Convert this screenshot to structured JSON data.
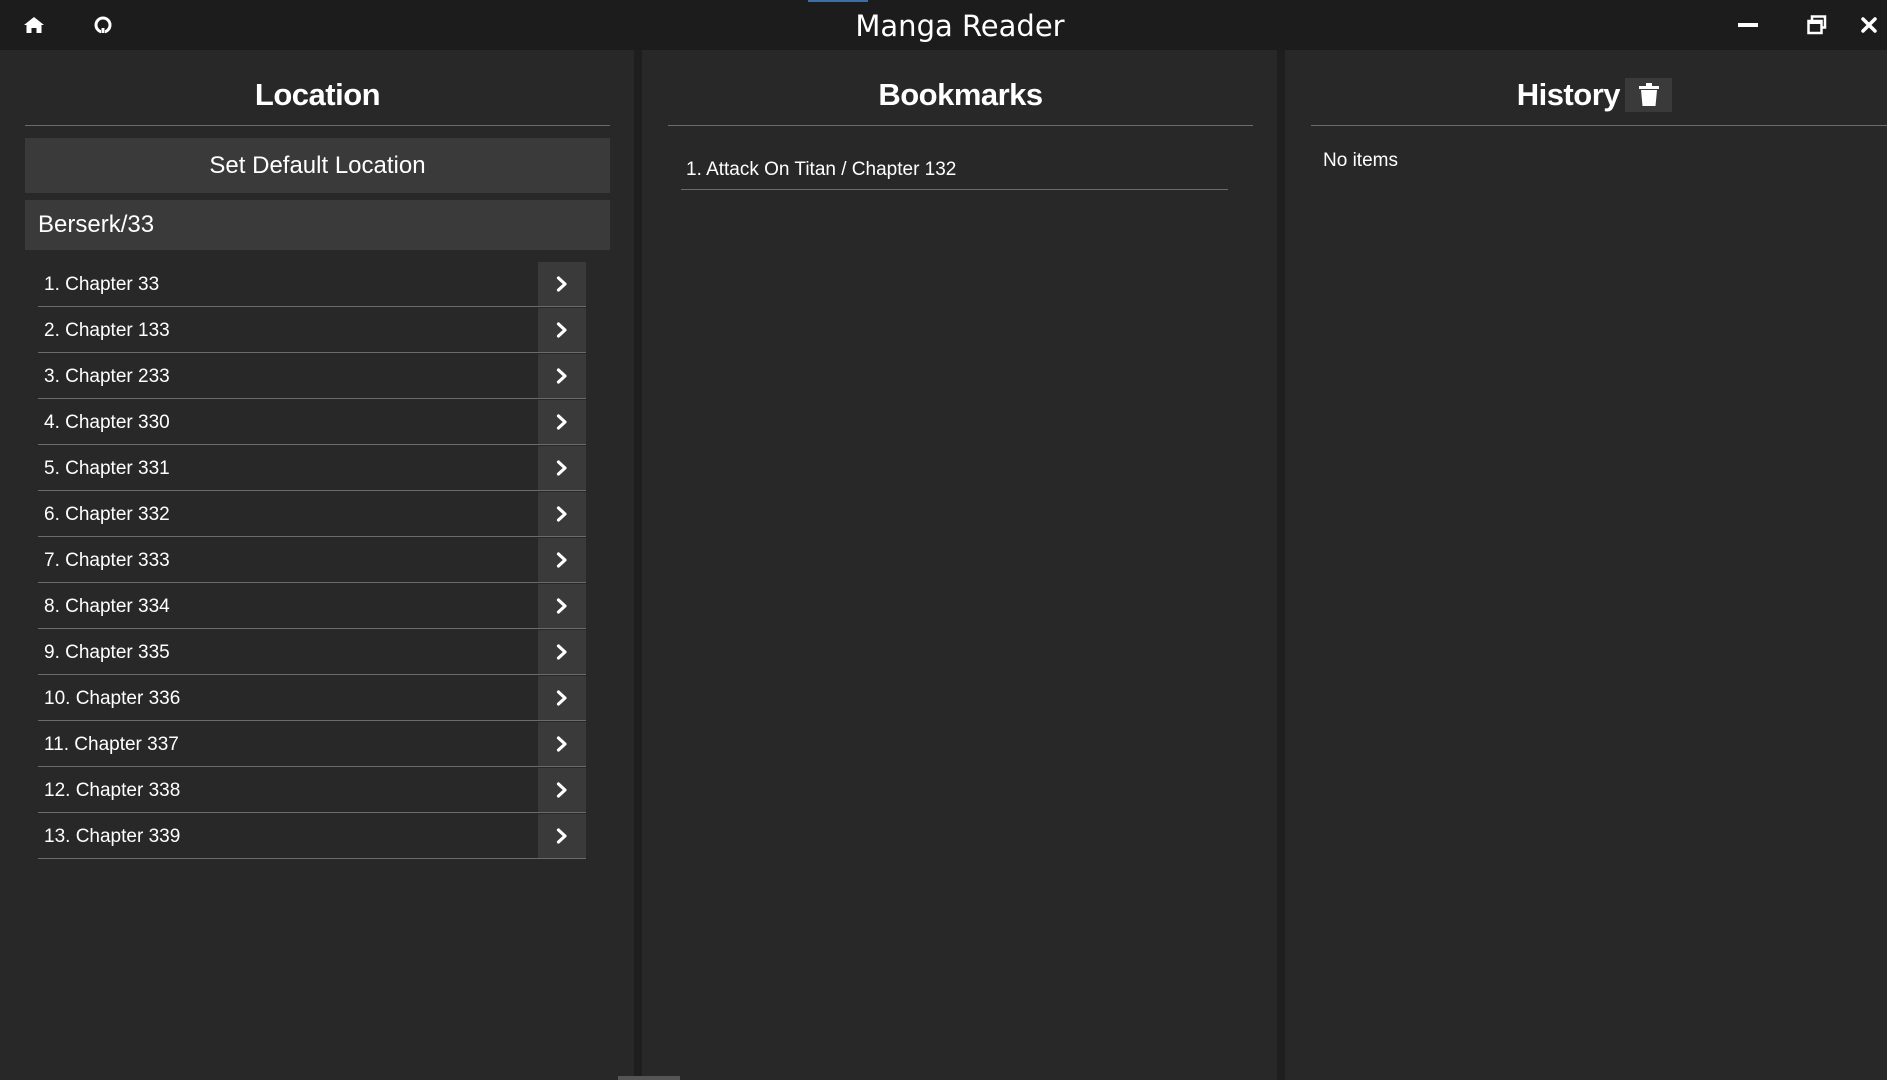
{
  "app": {
    "title": "Manga Reader"
  },
  "titlebar": {
    "home_icon": "home-icon",
    "github_icon": "github-icon",
    "minimize_icon": "minimize-icon",
    "restore_icon": "restore-icon",
    "close_icon": "close-icon"
  },
  "location": {
    "heading": "Location",
    "set_default_label": "Set Default Location",
    "path_value": "Berserk/33",
    "chapters": [
      "1. Chapter 33",
      "2. Chapter 133",
      "3. Chapter 233",
      "4. Chapter 330",
      "5. Chapter 331",
      "6. Chapter 332",
      "7. Chapter 333",
      "8. Chapter 334",
      "9. Chapter 335",
      "10. Chapter 336",
      "11. Chapter 337",
      "12. Chapter 338",
      "13. Chapter 339"
    ]
  },
  "bookmarks": {
    "heading": "Bookmarks",
    "items": [
      "1. Attack On Titan / Chapter 132"
    ]
  },
  "history": {
    "heading": "History",
    "empty_text": "No items"
  },
  "colors": {
    "background": "#272727",
    "titlebar": "#1c1c1c",
    "button": "#3a3a3a",
    "text": "#ffffff",
    "focus": "#3a6ea5"
  }
}
